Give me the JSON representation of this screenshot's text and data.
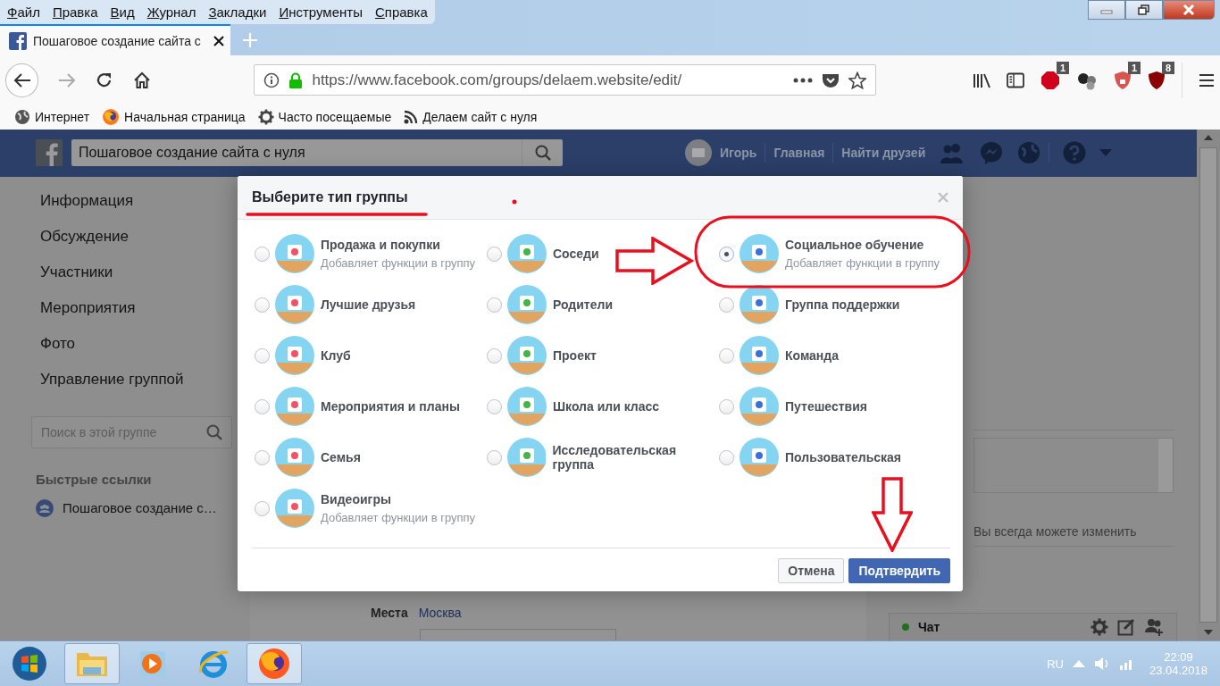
{
  "menu_bar": [
    "Файл",
    "Правка",
    "Вид",
    "Журнал",
    "Закладки",
    "Инструменты",
    "Справка"
  ],
  "tab": {
    "title": "Пошаговое создание сайта с",
    "selected": true
  },
  "address_bar": {
    "url": "https://www.facebook.com/groups/delaem.website/edit/"
  },
  "extensions": [
    {
      "kind": "adblock",
      "badge": "1"
    },
    {
      "kind": "balls"
    },
    {
      "kind": "shield",
      "badge": "1"
    },
    {
      "kind": "ublock",
      "badge": "8"
    }
  ],
  "bookmarks": [
    {
      "kind": "globe",
      "label": "Интернет"
    },
    {
      "kind": "firefox",
      "label": "Начальная страница"
    },
    {
      "kind": "gear",
      "label": "Часто посещаемые"
    },
    {
      "kind": "rss",
      "label": "Делаем сайт с нуля"
    }
  ],
  "facebook_header": {
    "search_value": "Пошаговое создание сайта с нуля",
    "user": "Игорь",
    "links": [
      "Главная",
      "Найти друзей"
    ]
  },
  "sidebar": {
    "items": [
      "Информация",
      "Обсуждение",
      "Участники",
      "Мероприятия",
      "Фото",
      "Управление группой"
    ],
    "search_placeholder": "Поиск в этой группе",
    "quick_links_title": "Быстрые ссылки",
    "quick_links": [
      "Пошаговое создание с…"
    ]
  },
  "background": {
    "places_label": "Места",
    "places_value": "Москва",
    "hint": "Вы всегда можете изменить",
    "chat": "Чат"
  },
  "dialog": {
    "title": "Выберите тип группы",
    "options": [
      {
        "label": "Продажа и покупки",
        "subtitle": "Добавляет функции в группу",
        "selected": false
      },
      {
        "label": "Соседи",
        "selected": false
      },
      {
        "label": "Социальное обучение",
        "subtitle": "Добавляет функции в группу",
        "selected": true
      },
      {
        "label": "Лучшие друзья",
        "selected": false
      },
      {
        "label": "Родители",
        "selected": false
      },
      {
        "label": "Группа поддержки",
        "selected": false
      },
      {
        "label": "Клуб",
        "selected": false
      },
      {
        "label": "Проект",
        "selected": false
      },
      {
        "label": "Команда",
        "selected": false
      },
      {
        "label": "Мероприятия и планы",
        "selected": false
      },
      {
        "label": "Школа или класс",
        "selected": false
      },
      {
        "label": "Путешествия",
        "selected": false
      },
      {
        "label": "Семья",
        "selected": false
      },
      {
        "label": "Исследовательская группа",
        "selected": false
      },
      {
        "label": "Пользовательская",
        "selected": false
      },
      {
        "label": "Видеоигры",
        "subtitle": "Добавляет функции в группу",
        "selected": false
      }
    ],
    "buttons": [
      {
        "kind": "secondary",
        "label": "Отмена"
      },
      {
        "kind": "primary",
        "label": "Подтвердить"
      }
    ]
  },
  "taskbar": {
    "apps": [
      {
        "kind": "explorer",
        "running": true
      },
      {
        "kind": "media",
        "running": false
      },
      {
        "kind": "ie",
        "running": false
      },
      {
        "kind": "firefox",
        "running": true
      }
    ]
  },
  "tray": {
    "language": "RU",
    "time": "22:09",
    "date": "23.04.2018"
  }
}
